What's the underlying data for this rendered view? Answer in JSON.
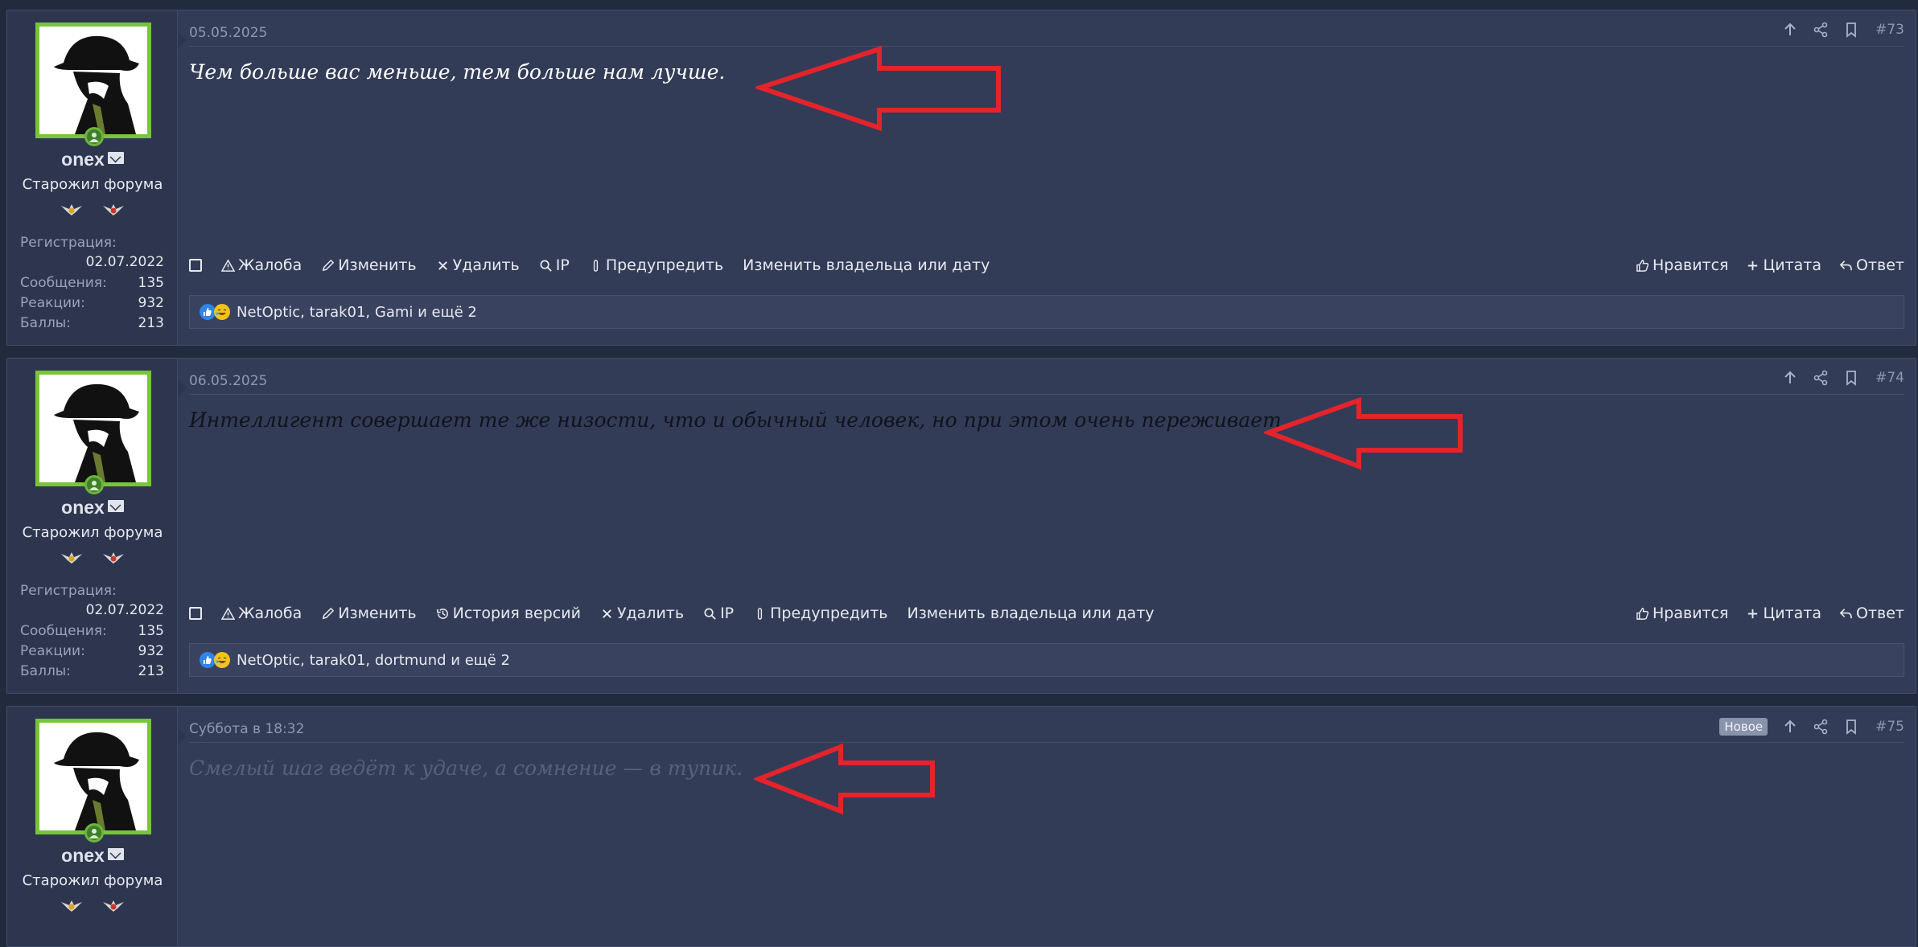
{
  "user": {
    "name": "onex",
    "title": "Старожил форума",
    "stats": {
      "reg_label": "Регистрация:",
      "reg_value": "02.07.2022",
      "msg_label": "Сообщения:",
      "msg_value": "135",
      "react_label": "Реакции:",
      "react_value": "932",
      "points_label": "Баллы:",
      "points_value": "213"
    }
  },
  "posts": [
    {
      "date": "05.05.2025",
      "number": "#73",
      "text": "Чем больше вас меньше, тем больше нам лучше.",
      "actions": [
        "Жалоба",
        "Изменить",
        "Удалить",
        "IP",
        "Предупредить",
        "Изменить владельца или дату"
      ],
      "reactions": "NetOptic, tarak01, Gami и ещё 2"
    },
    {
      "date": "06.05.2025",
      "number": "#74",
      "text": "Интеллигент совершает те же низости, что и обычный человек, но при этом очень переживает.",
      "actions": [
        "Жалоба",
        "Изменить",
        "История версий",
        "Удалить",
        "IP",
        "Предупредить",
        "Изменить владельца или дату"
      ],
      "reactions": "NetOptic, tarak01, dortmund и ещё 2"
    },
    {
      "date": "Суббота в 18:32",
      "number": "#75",
      "badge": "Новое",
      "text": "Смелый шаг ведёт к удаче, а сомнение — в тупик."
    }
  ],
  "right_actions": {
    "like": "Нравится",
    "quote": "Цитата",
    "reply": "Ответ"
  },
  "colors": {
    "background": "#222a3d",
    "post_bg": "#333c57",
    "avatar_border": "#78c43a",
    "arrow_red": "#e5232b",
    "like_blue": "#2f86e8"
  },
  "icons": [
    "share-icon",
    "bookmark-icon",
    "arrow-up-icon",
    "report-icon",
    "pencil-icon",
    "close-icon",
    "search-icon",
    "warning-icon",
    "history-icon",
    "thumbs-up-icon",
    "plus-icon",
    "reply-icon"
  ]
}
